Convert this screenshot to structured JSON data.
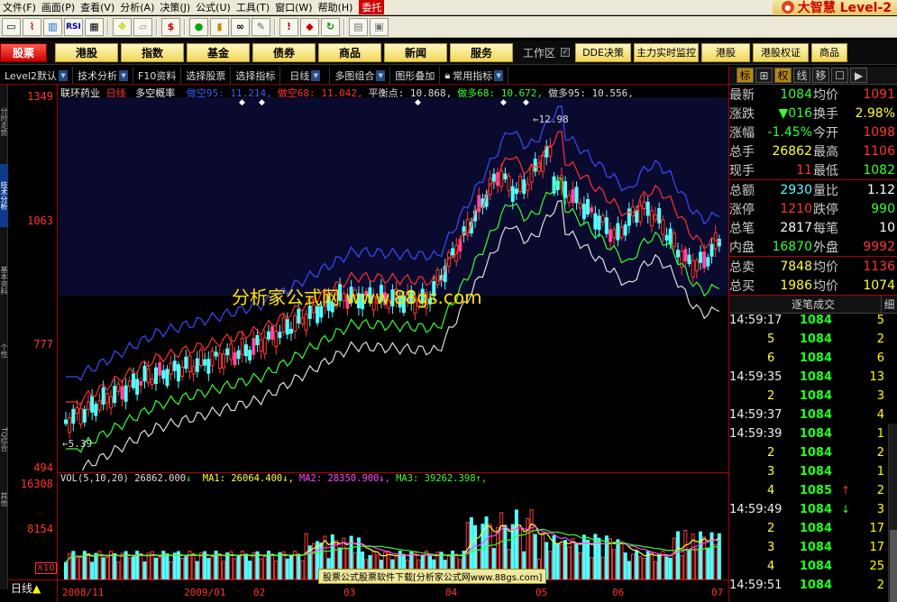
{
  "menu": {
    "items": [
      "文件(F)",
      "画面(P)",
      "查看(V)",
      "分析(A)",
      "决策(J)",
      "公式(U)",
      "工具(T)",
      "窗口(W)",
      "帮助(H)"
    ],
    "weituo": "委托",
    "brand": "大智慧 Level-2"
  },
  "toolbar": {
    "icons": [
      "window-icon",
      "chart-icon",
      "kline-icon",
      "rsi-icon",
      "grid-icon",
      "move-icon",
      "ruler-icon",
      "dollar-icon",
      "traffic-icon",
      "signal-icon",
      "binoculars-icon",
      "tools-icon",
      "alert-icon",
      "f10-icon",
      "refresh-icon",
      "db-icon",
      "window2-icon"
    ],
    "rsi_label": "RSI",
    "dollar_label": "$"
  },
  "navbar": {
    "buttons": [
      "股票",
      "港股",
      "指数",
      "基金",
      "债券",
      "商品",
      "新闻",
      "服务"
    ],
    "workarea": "工作区",
    "right_buttons": [
      "DDE决策",
      "主力实时监控",
      "港股",
      "港股权证",
      "商品"
    ]
  },
  "subbar": {
    "items": [
      "Level2默认",
      "技术分析",
      "F10资料",
      "选择股票",
      "选择指标",
      "日线",
      "多图组合",
      "图形叠加",
      "常用指标"
    ]
  },
  "sidetabs": [
    "分时走势",
    "技术分析",
    "基本资料",
    "个性",
    "TQ综合",
    "其他"
  ],
  "chart": {
    "stock": "联环药业",
    "period": "日线",
    "indicator": "多空概率",
    "params": [
      {
        "label": "做空95:",
        "value": "11.214",
        "color": "#3a5bff"
      },
      {
        "label": "做空68:",
        "value": "11.042",
        "color": "#ff3030"
      },
      {
        "label": "平衡点:",
        "value": "10.868",
        "color": "#dddddd"
      },
      {
        "label": "做多68:",
        "value": "10.672",
        "color": "#33ff33"
      },
      {
        "label": "做多95:",
        "value": "10.556",
        "color": "#dddddd"
      }
    ],
    "high_label": "12.98",
    "low_label": "5.39",
    "y_labels": [
      "1349",
      "1063",
      "777",
      "494"
    ],
    "vol_y_labels": [
      "16308",
      "8154"
    ],
    "vol_title": "VOL(5,10,20)",
    "vol_value": "26862.000",
    "ma": [
      {
        "label": "MA1:",
        "value": "26064.400",
        "color": "#ffff33"
      },
      {
        "label": "MA2:",
        "value": "28350.900",
        "color": "#ff44ff"
      },
      {
        "label": "MA3:",
        "value": "39262.398",
        "color": "#33ff33"
      }
    ],
    "x_labels": [
      "2008/11",
      "2009/01",
      "02",
      "03",
      "04",
      "05",
      "06",
      "07"
    ],
    "x_multiplier": "X10",
    "day_label": "日线",
    "watermark": "分析家公式网 www.88gs.com",
    "footer": "股票公式股票软件下载[分析家公式网www.88gs.com]"
  },
  "quote": {
    "rows": [
      {
        "k1": "最新",
        "v1": "1084",
        "c1": "#33ff33",
        "k2": "均价",
        "v2": "1091",
        "c2": "#ff3333"
      },
      {
        "k1": "涨跌",
        "v1": "▼016",
        "c1": "#33ff33",
        "k2": "换手",
        "v2": "2.98%",
        "c2": "#ffff33"
      },
      {
        "k1": "涨幅",
        "v1": "-1.45%",
        "c1": "#33ff33",
        "k2": "今开",
        "v2": "1098",
        "c2": "#ff3333"
      },
      {
        "k1": "总手",
        "v1": "26862",
        "c1": "#ffff33",
        "k2": "最高",
        "v2": "1106",
        "c2": "#ff3333"
      },
      {
        "k1": "现手",
        "v1": "11",
        "c1": "#ff3333",
        "k2": "最低",
        "v2": "1082",
        "c2": "#33ff33"
      },
      {
        "k1": "总额",
        "v1": "2930",
        "c1": "#55ffff",
        "k2": "量比",
        "v2": "1.12",
        "c2": "#ffffff"
      },
      {
        "k1": "涨停",
        "v1": "1210",
        "c1": "#ff3333",
        "k2": "跌停",
        "v2": "990",
        "c2": "#33ff33"
      },
      {
        "k1": "总笔",
        "v1": "2817",
        "c1": "#ffffff",
        "k2": "每笔",
        "v2": "10",
        "c2": "#ffffff"
      },
      {
        "k1": "内盘",
        "v1": "16870",
        "c1": "#33ff33",
        "k2": "外盘",
        "v2": "9992",
        "c2": "#ff3333"
      },
      {
        "k1": "总卖",
        "v1": "7848",
        "c1": "#ffff33",
        "k2": "均价",
        "v2": "1136",
        "c2": "#ff3333"
      },
      {
        "k1": "总买",
        "v1": "1986",
        "c1": "#ffff33",
        "k2": "均价",
        "v2": "1074",
        "c2": "#ffff33"
      }
    ],
    "tabs": [
      "标",
      "⊞",
      "权",
      "线",
      "移",
      "☐",
      "▶"
    ]
  },
  "trades": {
    "title": "逐笔成交",
    "detail": "细",
    "rows": [
      {
        "t": "14:59:17",
        "p": "1084",
        "a": "",
        "q": "5"
      },
      {
        "t": "5",
        "p": "1084",
        "a": "",
        "q": "2"
      },
      {
        "t": "6",
        "p": "1084",
        "a": "",
        "q": "6"
      },
      {
        "t": "14:59:35",
        "p": "1084",
        "a": "",
        "q": "13"
      },
      {
        "t": "2",
        "p": "1084",
        "a": "",
        "q": "3"
      },
      {
        "t": "14:59:37",
        "p": "1084",
        "a": "",
        "q": "4"
      },
      {
        "t": "14:59:39",
        "p": "1084",
        "a": "",
        "q": "1"
      },
      {
        "t": "2",
        "p": "1084",
        "a": "",
        "q": "2"
      },
      {
        "t": "3",
        "p": "1084",
        "a": "",
        "q": "1"
      },
      {
        "t": "4",
        "p": "1085",
        "a": "↑",
        "q": "2"
      },
      {
        "t": "14:59:49",
        "p": "1084",
        "a": "↓",
        "q": "3"
      },
      {
        "t": "2",
        "p": "1084",
        "a": "",
        "q": "17"
      },
      {
        "t": "3",
        "p": "1084",
        "a": "",
        "q": "17"
      },
      {
        "t": "4",
        "p": "1084",
        "a": "",
        "q": "25"
      },
      {
        "t": "14:59:51",
        "p": "1084",
        "a": "",
        "q": "2"
      }
    ]
  }
}
